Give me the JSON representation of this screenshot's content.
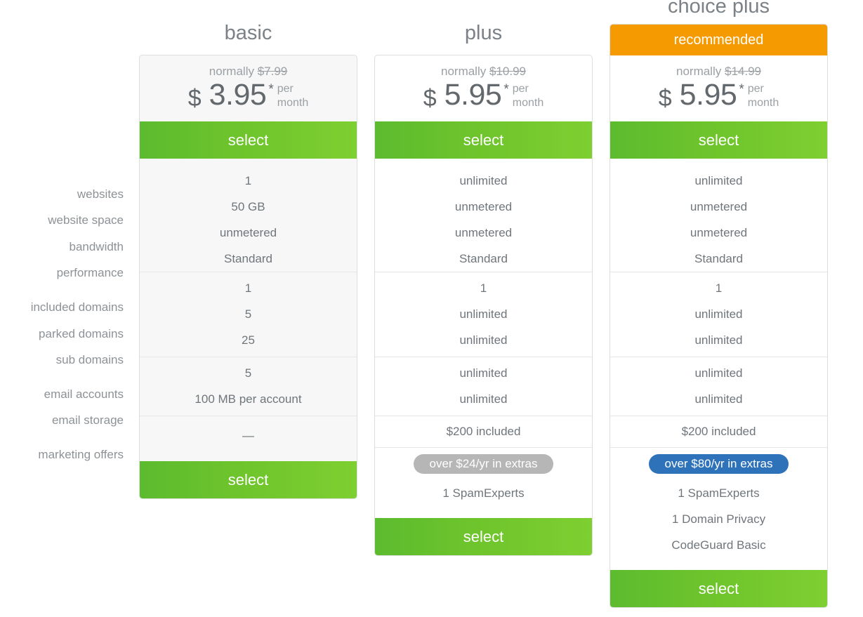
{
  "feature_labels": [
    "websites",
    "website space",
    "bandwidth",
    "performance",
    "included domains",
    "parked domains",
    "sub domains",
    "email accounts",
    "email storage",
    "marketing offers"
  ],
  "colors": {
    "accent_green": "#6ec42c",
    "recommended_orange": "#f59a00",
    "pill_gray": "#b6b6b6",
    "pill_blue": "#2e72ba",
    "label_text": "#8d9296",
    "value_text": "#6f767b"
  },
  "select_label": "select",
  "recommended_label": "recommended",
  "normally_word": "normally",
  "currency_symbol": "$",
  "asterisk": "*",
  "per_word": "per",
  "month_word": "month",
  "plans": [
    {
      "id": "basic",
      "title": "basic",
      "recommended": false,
      "shaded": true,
      "normally_price": "$7.99",
      "price": "3.95",
      "groups": [
        {
          "rows": [
            "1",
            "50 GB",
            "unmetered",
            "Standard"
          ]
        },
        {
          "rows": [
            "1",
            "5",
            "25"
          ]
        },
        {
          "rows": [
            "5",
            "100 MB per account"
          ]
        },
        {
          "rows": [
            "—"
          ]
        }
      ],
      "extras_pill": null,
      "extras_rows": []
    },
    {
      "id": "plus",
      "title": "plus",
      "recommended": false,
      "shaded": false,
      "normally_price": "$10.99",
      "price": "5.95",
      "groups": [
        {
          "rows": [
            "unlimited",
            "unmetered",
            "unmetered",
            "Standard"
          ]
        },
        {
          "rows": [
            "1",
            "unlimited",
            "unlimited"
          ]
        },
        {
          "rows": [
            "unlimited",
            "unlimited"
          ]
        },
        {
          "rows": [
            "$200 included"
          ]
        }
      ],
      "extras_pill": {
        "label": "over $24/yr in extras",
        "style": "gray"
      },
      "extras_rows": [
        "1 SpamExperts"
      ]
    },
    {
      "id": "choice-plus",
      "title": "choice plus",
      "recommended": true,
      "shaded": false,
      "normally_price": "$14.99",
      "price": "5.95",
      "groups": [
        {
          "rows": [
            "unlimited",
            "unmetered",
            "unmetered",
            "Standard"
          ]
        },
        {
          "rows": [
            "1",
            "unlimited",
            "unlimited"
          ]
        },
        {
          "rows": [
            "unlimited",
            "unlimited"
          ]
        },
        {
          "rows": [
            "$200 included"
          ]
        }
      ],
      "extras_pill": {
        "label": "over $80/yr in extras",
        "style": "blue"
      },
      "extras_rows": [
        "1 SpamExperts",
        "1 Domain Privacy",
        "CodeGuard Basic"
      ]
    }
  ]
}
